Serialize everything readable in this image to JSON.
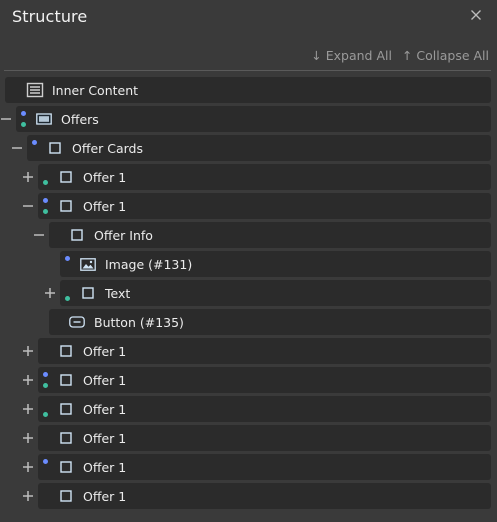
{
  "panel": {
    "title": "Structure"
  },
  "toolbar": {
    "expand_label": "↓ Expand All",
    "collapse_label": "↑ Collapse All"
  },
  "tree": {
    "items": [
      {
        "label": "Inner Content",
        "icon": "content-list-icon",
        "toggle": "none",
        "dot_blue": false,
        "dot_green": false,
        "depth": 0
      },
      {
        "label": "Offers",
        "icon": "section-icon",
        "toggle": "collapse",
        "dot_blue": true,
        "dot_green": true,
        "depth": 1
      },
      {
        "label": "Offer Cards",
        "icon": "container-icon",
        "toggle": "collapse",
        "dot_blue": true,
        "dot_green": false,
        "depth": 2
      },
      {
        "label": "Offer 1",
        "icon": "container-icon",
        "toggle": "expand",
        "dot_blue": false,
        "dot_green": true,
        "depth": 3
      },
      {
        "label": "Offer 1",
        "icon": "container-icon",
        "toggle": "collapse",
        "dot_blue": true,
        "dot_green": true,
        "depth": 3
      },
      {
        "label": "Offer Info",
        "icon": "container-icon",
        "toggle": "collapse",
        "dot_blue": false,
        "dot_green": false,
        "depth": 4
      },
      {
        "label": "Image (#131)",
        "icon": "image-icon",
        "toggle": "none",
        "dot_blue": true,
        "dot_green": false,
        "depth": 5
      },
      {
        "label": "Text",
        "icon": "container-icon",
        "toggle": "expand",
        "dot_blue": false,
        "dot_green": true,
        "depth": 5
      },
      {
        "label": "Button (#135)",
        "icon": "button-icon",
        "toggle": "none",
        "dot_blue": false,
        "dot_green": false,
        "depth": 4
      },
      {
        "label": "Offer 1",
        "icon": "container-icon",
        "toggle": "expand",
        "dot_blue": false,
        "dot_green": false,
        "depth": 3
      },
      {
        "label": "Offer 1",
        "icon": "container-icon",
        "toggle": "expand",
        "dot_blue": true,
        "dot_green": true,
        "depth": 3
      },
      {
        "label": "Offer 1",
        "icon": "container-icon",
        "toggle": "expand",
        "dot_blue": false,
        "dot_green": true,
        "depth": 3
      },
      {
        "label": "Offer 1",
        "icon": "container-icon",
        "toggle": "expand",
        "dot_blue": false,
        "dot_green": false,
        "depth": 3
      },
      {
        "label": "Offer 1",
        "icon": "container-icon",
        "toggle": "expand",
        "dot_blue": true,
        "dot_green": false,
        "depth": 3
      },
      {
        "label": "Offer 1",
        "icon": "container-icon",
        "toggle": "expand",
        "dot_blue": false,
        "dot_green": false,
        "depth": 3
      }
    ]
  },
  "colors": {
    "background": "#3a3a3a",
    "row": "#2b2b2b",
    "accent_blue": "#6b8cff",
    "accent_green": "#3fbf9f",
    "icon": "#d0e4f5"
  }
}
